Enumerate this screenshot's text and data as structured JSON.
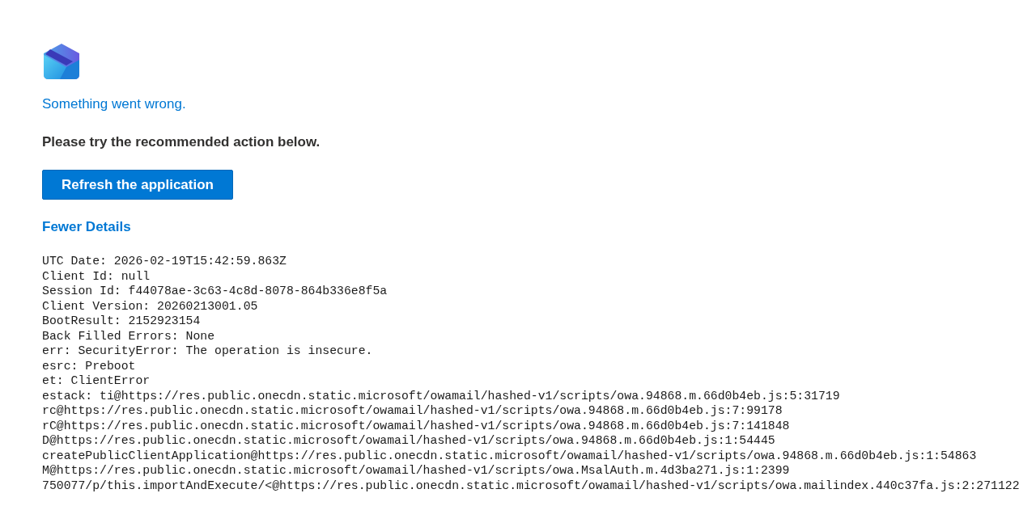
{
  "error_title": "Something went wrong.",
  "instruction": "Please try the recommended action below.",
  "refresh_button": "Refresh the application",
  "details_toggle": "Fewer Details",
  "details": [
    "UTC Date: 2026-02-19T15:42:59.863Z",
    "Client Id: null",
    "Session Id: f44078ae-3c63-4c8d-8078-864b336e8f5a",
    "Client Version: 20260213001.05",
    "BootResult: 2152923154",
    "Back Filled Errors: None",
    "err: SecurityError: The operation is insecure.",
    "esrc: Preboot",
    "et: ClientError",
    "estack: ti@https://res.public.onecdn.static.microsoft/owamail/hashed-v1/scripts/owa.94868.m.66d0b4eb.js:5:31719",
    "rc@https://res.public.onecdn.static.microsoft/owamail/hashed-v1/scripts/owa.94868.m.66d0b4eb.js:7:99178",
    "rC@https://res.public.onecdn.static.microsoft/owamail/hashed-v1/scripts/owa.94868.m.66d0b4eb.js:7:141848",
    "D@https://res.public.onecdn.static.microsoft/owamail/hashed-v1/scripts/owa.94868.m.66d0b4eb.js:1:54445",
    "createPublicClientApplication@https://res.public.onecdn.static.microsoft/owamail/hashed-v1/scripts/owa.94868.m.66d0b4eb.js:1:54863",
    "M@https://res.public.onecdn.static.microsoft/owamail/hashed-v1/scripts/owa.MsalAuth.m.4d3ba271.js:1:2399",
    "750077/p/this.importAndExecute/<@https://res.public.onecdn.static.microsoft/owamail/hashed-v1/scripts/owa.mailindex.440c37fa.js:2:271122"
  ]
}
